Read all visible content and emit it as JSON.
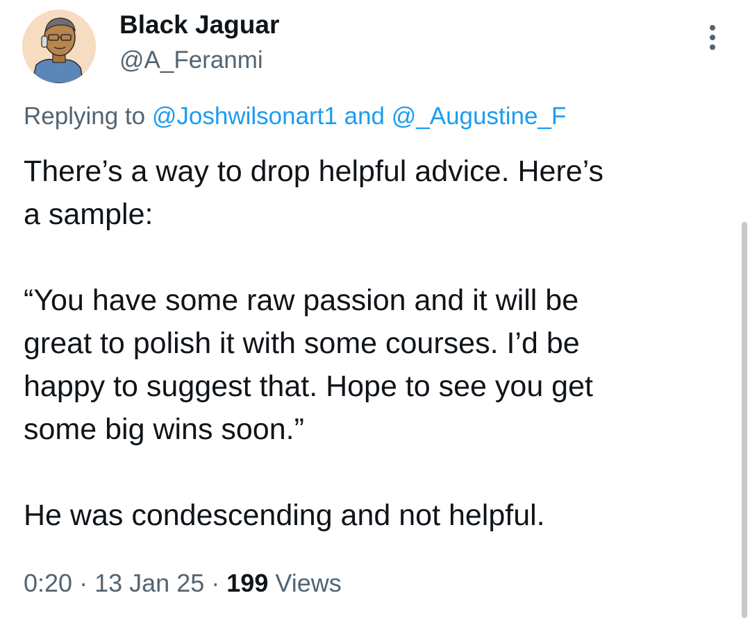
{
  "author": {
    "display_name": "Black Jaguar",
    "handle": "@A_Feranmi",
    "avatar_icon": "cartoon-man-avatar"
  },
  "reply_context": {
    "prefix": "Replying to",
    "mention_1": "@Joshwilsonart1",
    "conjunction": "and",
    "mention_2": "@_Augustine_F"
  },
  "tweet": {
    "paragraph_1_line_1": "There’s a way to drop helpful advice. Here’s",
    "paragraph_1_line_2": "a sample:",
    "paragraph_2_line_1": "“You have some raw passion and it will be",
    "paragraph_2_line_2": "great to polish it with some courses. I’d be",
    "paragraph_2_line_3": "happy to suggest that. Hope to see you get",
    "paragraph_2_line_4": "some big wins soon.”",
    "paragraph_3_line_1": "He was condescending and not helpful."
  },
  "meta": {
    "time": "0:20",
    "separator_1": "·",
    "date": "13 Jan 25",
    "separator_2": "·",
    "views_count": "199",
    "views_label": "Views"
  },
  "more_menu_icon": "more-vertical-icon",
  "colors": {
    "text_primary": "#0f1419",
    "text_secondary": "#536471",
    "mention": "#1d9bf0",
    "avatar_bg": "#f6dcc0"
  }
}
